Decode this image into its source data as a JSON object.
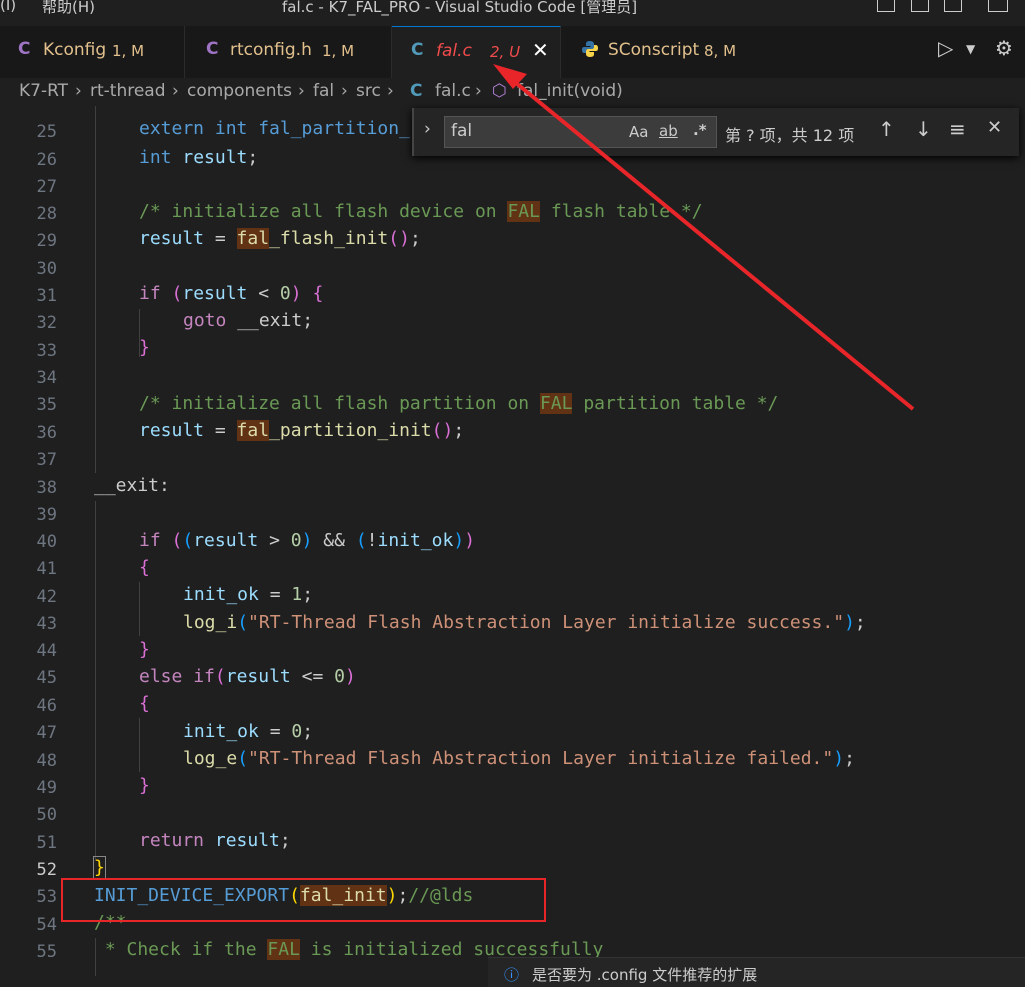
{
  "window": {
    "menu_prefix": "(I)",
    "menu_help": "帮助(H)",
    "title": "fal.c - K7_FAL_PRO - Visual Studio Code [管理员]"
  },
  "tabs": [
    {
      "icon": "C",
      "icon_color": "#a074c4",
      "name": "Kconfig",
      "status": "1, M",
      "color": "#e2c08d"
    },
    {
      "icon": "C",
      "icon_color": "#a074c4",
      "name": "rtconfig.h",
      "status": "1, M",
      "color": "#e2c08d"
    },
    {
      "icon": "C",
      "icon_color": "#519aba",
      "name": "fal.c",
      "status": "2, U",
      "color": "#f14c4c",
      "active": true
    },
    {
      "icon": "python",
      "icon_color": "#3572a5",
      "name": "SConscript",
      "status": "8, M",
      "color": "#e2c08d"
    }
  ],
  "breadcrumb": [
    "K7-RT",
    "rt-thread",
    "components",
    "fal",
    "src",
    "fal.c",
    "fal_init(void)"
  ],
  "find": {
    "value": "fal",
    "match_case": "Aa",
    "whole_word": "ab",
    "regex": ".*",
    "result": "第 ? 项，共 12 项"
  },
  "editor": {
    "line_numbers": [
      "25",
      "26",
      "27",
      "28",
      "29",
      "30",
      "31",
      "32",
      "33",
      "34",
      "35",
      "36",
      "37",
      "38",
      "39",
      "40",
      "41",
      "42",
      "43",
      "44",
      "45",
      "46",
      "47",
      "48",
      "49",
      "50",
      "51",
      "52",
      "53",
      "54",
      "55"
    ],
    "current_line": "52",
    "lines": {
      "l25": "extern int fal_partition_",
      "l26_kw": "int",
      "l26_v": "result",
      "l28_a": "/* initialize all flash device on ",
      "l28_b": "FAL",
      "l28_c": " flash table */",
      "l29_v": "result",
      "l29_fn_hl": "fal",
      "l29_fn": "_flash_init",
      "l31_kw": "if",
      "l31_v": "result",
      "l31_n": "0",
      "l32_kw": "goto",
      "l32_v": "__exit",
      "l35_a": "/* initialize all flash partition on ",
      "l35_b": "FAL",
      "l35_c": " partition table */",
      "l36_v": "result",
      "l36_fn_hl": "fal",
      "l36_fn": "_partition_init",
      "l38": "__exit:",
      "l40_kw": "if",
      "l40_v": "result",
      "l40_n": "0",
      "l40_v2": "init_ok",
      "l42_v": "init_ok",
      "l42_n": "1",
      "l43_fn": "log_i",
      "l43_s": "\"RT-Thread Flash Abstraction Layer initialize success.\"",
      "l45_kw": "else",
      "l45_kw2": "if",
      "l45_v": "result",
      "l45_n": "0",
      "l47_v": "init_ok",
      "l47_n": "0",
      "l48_fn": "log_e",
      "l48_s": "\"RT-Thread Flash Abstraction Layer initialize failed.\"",
      "l51_kw": "return",
      "l51_v": "result",
      "l53_mac": "INIT_DEVICE_EXPORT",
      "l53_fn": "fal_init",
      "l53_c": "//@lds",
      "l54": "/**",
      "l55_a": " * Check if the ",
      "l55_b": "FAL",
      "l55_c": " is initialized successfully"
    }
  },
  "notification": "是否要为 .config 文件推荐的扩展"
}
